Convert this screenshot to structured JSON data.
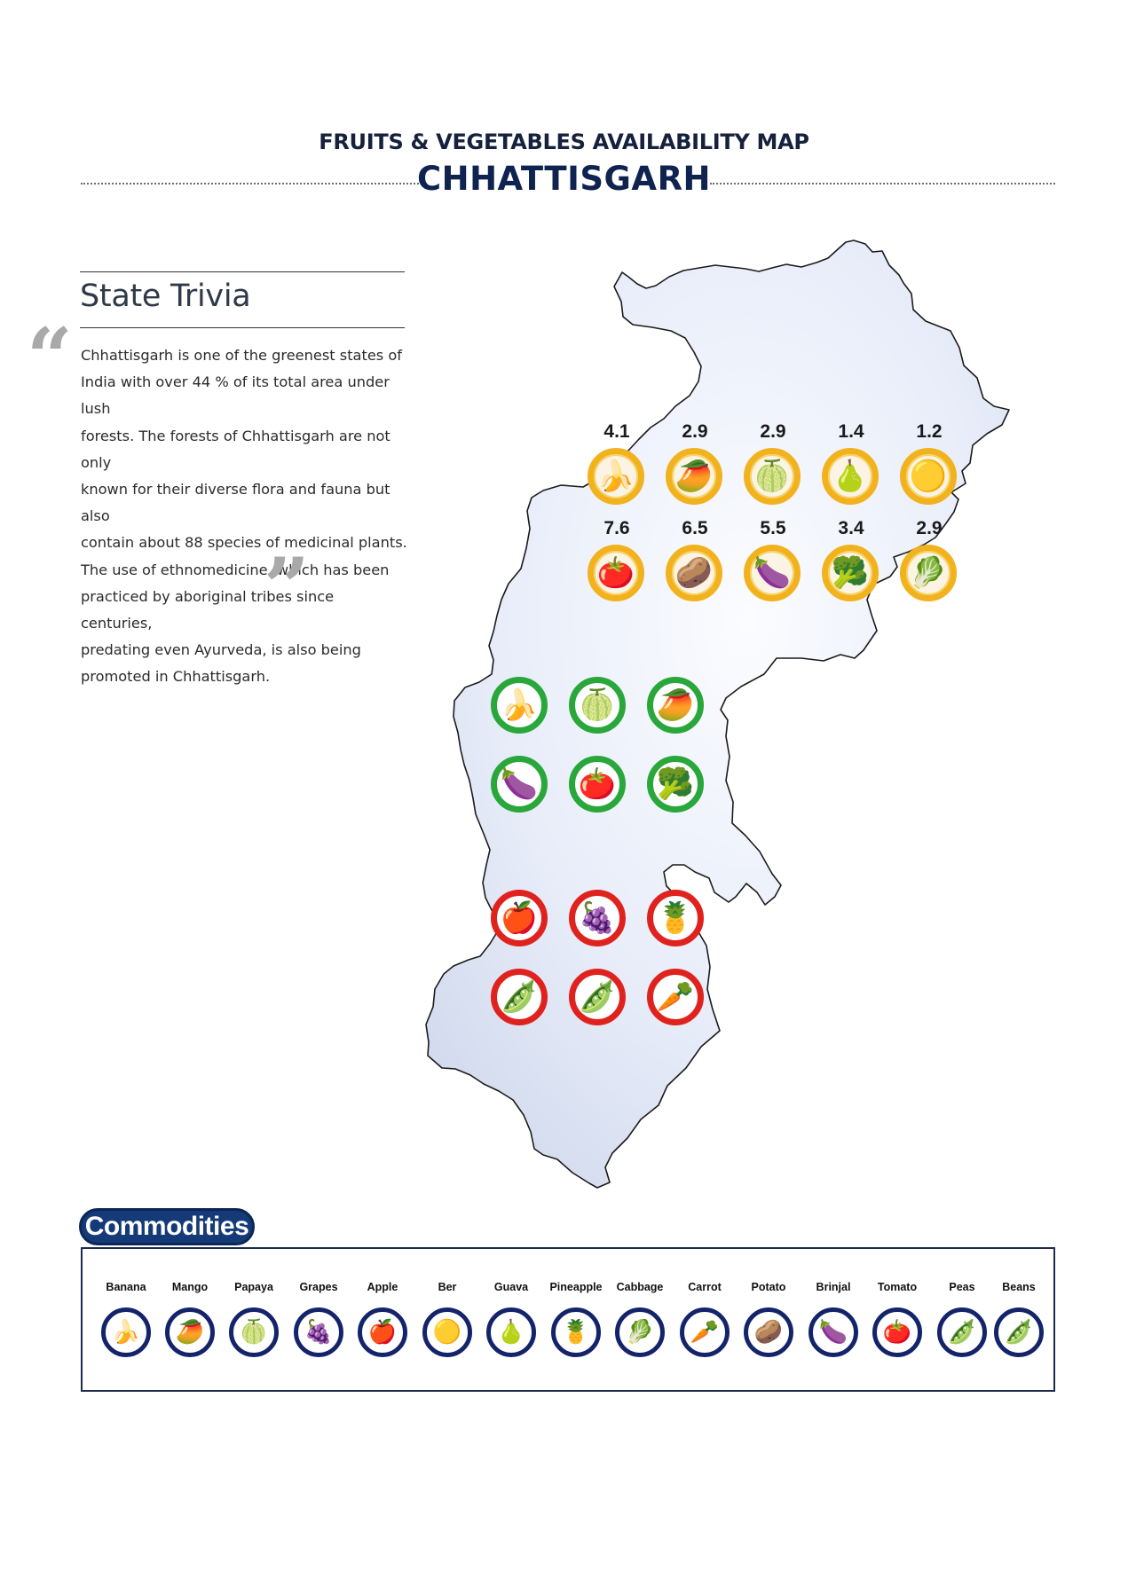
{
  "header": {
    "subtitle": "FRUITS & VEGETABLES AVAILABILITY MAP",
    "title": "CHHATTISGARH"
  },
  "trivia": {
    "heading": "State Trivia",
    "lines": [
      "Chhattisgarh is one of the greenest states of",
      "India with over 44 % of its total area under lush",
      "forests. The forests of Chhattisgarh are not only",
      "known for their diverse flora and fauna but also",
      "contain about 88 species of medicinal plants.",
      "The use of ethnomedicine, which has been",
      "practiced by aboriginal tribes since centuries,",
      "predating even Ayurveda, is also being",
      "promoted in Chhattisgarh."
    ],
    "quote_open": "“",
    "quote_close": "”"
  },
  "colors": {
    "surplus": "#f1b21d",
    "self_sufficient": "#29a73a",
    "deficit": "#e0221e",
    "map_fill": "#e6ebf8",
    "commodity_ring": "#14246a"
  },
  "map": {
    "surplus_rows": [
      [
        {
          "commodity": "Banana",
          "value": "4.1",
          "icon": "🍌"
        },
        {
          "commodity": "Mango",
          "value": "2.9",
          "icon": "🥭"
        },
        {
          "commodity": "Papaya",
          "value": "2.9",
          "icon": "🍈"
        },
        {
          "commodity": "Guava",
          "value": "1.4",
          "icon": "🍐"
        },
        {
          "commodity": "Ber",
          "value": "1.2",
          "icon": "🟡"
        }
      ],
      [
        {
          "commodity": "Tomato",
          "value": "7.6",
          "icon": "🍅"
        },
        {
          "commodity": "Potato",
          "value": "6.5",
          "icon": "🥔"
        },
        {
          "commodity": "Brinjal",
          "value": "5.5",
          "icon": "🍆"
        },
        {
          "commodity": "Cauliflower",
          "value": "3.4",
          "icon": "🥦"
        },
        {
          "commodity": "Cabbage",
          "value": "2.9",
          "icon": "🥬"
        }
      ]
    ],
    "self_sufficient_rows": [
      [
        {
          "commodity": "Banana",
          "icon": "🍌"
        },
        {
          "commodity": "Papaya",
          "icon": "🍈"
        },
        {
          "commodity": "Mango",
          "icon": "🥭"
        }
      ],
      [
        {
          "commodity": "Brinjal",
          "icon": "🍆"
        },
        {
          "commodity": "Tomato",
          "icon": "🍅"
        },
        {
          "commodity": "Cauliflower",
          "icon": "🥦"
        }
      ]
    ],
    "deficit_rows": [
      [
        {
          "commodity": "Apple",
          "icon": "🍎"
        },
        {
          "commodity": "Grapes",
          "icon": "🍇"
        },
        {
          "commodity": "Pineapple",
          "icon": "🍍"
        }
      ],
      [
        {
          "commodity": "Beans",
          "icon": "🫛"
        },
        {
          "commodity": "Peas",
          "icon": "🫛"
        },
        {
          "commodity": "Carrot",
          "icon": "🥕"
        }
      ]
    ]
  },
  "commodities": {
    "label": "Commodities",
    "items": [
      {
        "name": "Banana",
        "icon": "🍌"
      },
      {
        "name": "Mango",
        "icon": "🥭"
      },
      {
        "name": "Papaya",
        "icon": "🍈"
      },
      {
        "name": "Grapes",
        "icon": "🍇"
      },
      {
        "name": "Apple",
        "icon": "🍎"
      },
      {
        "name": "Ber",
        "icon": "🟡"
      },
      {
        "name": "Guava",
        "icon": "🍐"
      },
      {
        "name": "Pineapple",
        "icon": "🍍"
      },
      {
        "name": "Cabbage",
        "icon": "🥬"
      },
      {
        "name": "Carrot",
        "icon": "🥕"
      },
      {
        "name": "Potato",
        "icon": "🥔"
      },
      {
        "name": "Brinjal",
        "icon": "🍆"
      },
      {
        "name": "Tomato",
        "icon": "🍅"
      },
      {
        "name": "Peas",
        "icon": "🫛"
      },
      {
        "name": "Beans",
        "icon": "🫛"
      }
    ]
  }
}
